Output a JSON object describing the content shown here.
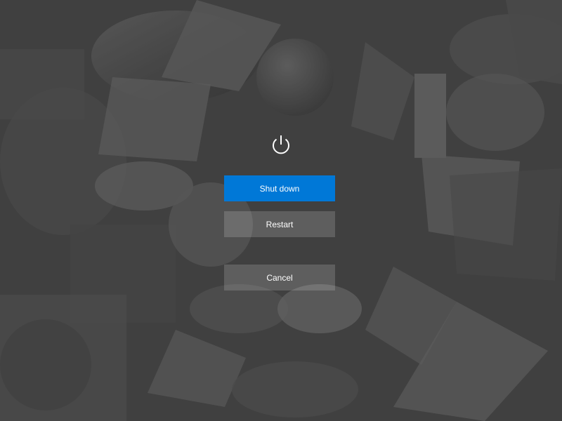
{
  "dialog": {
    "icon": "power-icon",
    "buttons": {
      "shutdown_label": "Shut down",
      "restart_label": "Restart",
      "cancel_label": "Cancel"
    }
  },
  "colors": {
    "primary": "#0078d7",
    "secondary": "#5c5c5c",
    "text": "#ffffff",
    "background": "#4a4a4a"
  }
}
